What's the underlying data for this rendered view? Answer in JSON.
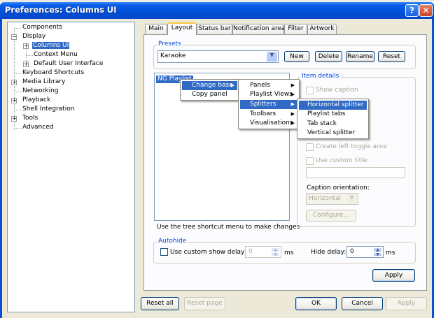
{
  "window": {
    "title": "Preferences: Columns UI"
  },
  "titlebar": {
    "help_glyph": "?",
    "close_glyph": "✕"
  },
  "tree": {
    "items": [
      {
        "label": "Components"
      },
      {
        "label": "Display"
      },
      {
        "label": "Columns UI"
      },
      {
        "label": "Context Menu"
      },
      {
        "label": "Default User Interface"
      },
      {
        "label": "Keyboard Shortcuts"
      },
      {
        "label": "Media Library"
      },
      {
        "label": "Networking"
      },
      {
        "label": "Playback"
      },
      {
        "label": "Shell Integration"
      },
      {
        "label": "Tools"
      },
      {
        "label": "Advanced"
      }
    ]
  },
  "tabs": [
    {
      "label": "Main"
    },
    {
      "label": "Layout"
    },
    {
      "label": "Status bar"
    },
    {
      "label": "Notification area"
    },
    {
      "label": "Filter"
    },
    {
      "label": "Artwork"
    }
  ],
  "presets": {
    "title": "Presets",
    "selected": "Karaoke",
    "new_label": "New",
    "delete_label": "Delete",
    "rename_label": "Rename",
    "reset_label": "Reset"
  },
  "layout_tree": {
    "root_item": "NG Playlist"
  },
  "hint": "Use the tree shortcut menu to make changes",
  "item_details": {
    "title": "Item details",
    "show_caption": "Show caption",
    "create_left_toggle": "Create left toggle area",
    "use_custom_title": "Use custom title:",
    "caption_orientation": "Caption orientation:",
    "orientation_value": "Horizontal",
    "configure_label": "Configure..."
  },
  "autohide": {
    "title": "Autohide",
    "custom_show_delay": "Use custom show delay of",
    "show_delay_value": "0",
    "ms1": "ms",
    "hide_delay_label": "Hide delay:",
    "hide_delay_value": "0",
    "ms2": "ms"
  },
  "buttons": {
    "apply_inner": "Apply",
    "reset_all": "Reset all",
    "reset_page": "Reset page",
    "ok": "OK",
    "cancel": "Cancel",
    "apply": "Apply"
  },
  "menu1": {
    "items": [
      {
        "label": "Change base"
      },
      {
        "label": "Copy panel"
      }
    ]
  },
  "menu2": {
    "items": [
      {
        "label": "Panels"
      },
      {
        "label": "Playlist Views"
      },
      {
        "label": "Splitters"
      },
      {
        "label": "Toolbars"
      },
      {
        "label": "Visualisations"
      }
    ]
  },
  "menu3": {
    "items": [
      {
        "label": "Horizontal splitter"
      },
      {
        "label": "Playlist tabs"
      },
      {
        "label": "Tab stack"
      },
      {
        "label": "Vertical splitter"
      }
    ]
  },
  "colors": {
    "title_bar": "#0050d8",
    "selection": "#316ac5",
    "group_title": "#0046d5",
    "face": "#ece9d8"
  }
}
